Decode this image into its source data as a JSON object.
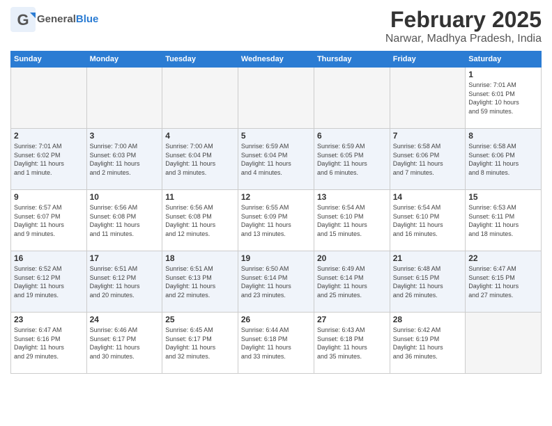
{
  "header": {
    "logo_general": "General",
    "logo_blue": "Blue",
    "main_title": "February 2025",
    "subtitle": "Narwar, Madhya Pradesh, India"
  },
  "columns": [
    "Sunday",
    "Monday",
    "Tuesday",
    "Wednesday",
    "Thursday",
    "Friday",
    "Saturday"
  ],
  "weeks": [
    {
      "shaded": false,
      "days": [
        {
          "num": "",
          "info": ""
        },
        {
          "num": "",
          "info": ""
        },
        {
          "num": "",
          "info": ""
        },
        {
          "num": "",
          "info": ""
        },
        {
          "num": "",
          "info": ""
        },
        {
          "num": "",
          "info": ""
        },
        {
          "num": "1",
          "info": "Sunrise: 7:01 AM\nSunset: 6:01 PM\nDaylight: 10 hours\nand 59 minutes."
        }
      ]
    },
    {
      "shaded": true,
      "days": [
        {
          "num": "2",
          "info": "Sunrise: 7:01 AM\nSunset: 6:02 PM\nDaylight: 11 hours\nand 1 minute."
        },
        {
          "num": "3",
          "info": "Sunrise: 7:00 AM\nSunset: 6:03 PM\nDaylight: 11 hours\nand 2 minutes."
        },
        {
          "num": "4",
          "info": "Sunrise: 7:00 AM\nSunset: 6:04 PM\nDaylight: 11 hours\nand 3 minutes."
        },
        {
          "num": "5",
          "info": "Sunrise: 6:59 AM\nSunset: 6:04 PM\nDaylight: 11 hours\nand 4 minutes."
        },
        {
          "num": "6",
          "info": "Sunrise: 6:59 AM\nSunset: 6:05 PM\nDaylight: 11 hours\nand 6 minutes."
        },
        {
          "num": "7",
          "info": "Sunrise: 6:58 AM\nSunset: 6:06 PM\nDaylight: 11 hours\nand 7 minutes."
        },
        {
          "num": "8",
          "info": "Sunrise: 6:58 AM\nSunset: 6:06 PM\nDaylight: 11 hours\nand 8 minutes."
        }
      ]
    },
    {
      "shaded": false,
      "days": [
        {
          "num": "9",
          "info": "Sunrise: 6:57 AM\nSunset: 6:07 PM\nDaylight: 11 hours\nand 9 minutes."
        },
        {
          "num": "10",
          "info": "Sunrise: 6:56 AM\nSunset: 6:08 PM\nDaylight: 11 hours\nand 11 minutes."
        },
        {
          "num": "11",
          "info": "Sunrise: 6:56 AM\nSunset: 6:08 PM\nDaylight: 11 hours\nand 12 minutes."
        },
        {
          "num": "12",
          "info": "Sunrise: 6:55 AM\nSunset: 6:09 PM\nDaylight: 11 hours\nand 13 minutes."
        },
        {
          "num": "13",
          "info": "Sunrise: 6:54 AM\nSunset: 6:10 PM\nDaylight: 11 hours\nand 15 minutes."
        },
        {
          "num": "14",
          "info": "Sunrise: 6:54 AM\nSunset: 6:10 PM\nDaylight: 11 hours\nand 16 minutes."
        },
        {
          "num": "15",
          "info": "Sunrise: 6:53 AM\nSunset: 6:11 PM\nDaylight: 11 hours\nand 18 minutes."
        }
      ]
    },
    {
      "shaded": true,
      "days": [
        {
          "num": "16",
          "info": "Sunrise: 6:52 AM\nSunset: 6:12 PM\nDaylight: 11 hours\nand 19 minutes."
        },
        {
          "num": "17",
          "info": "Sunrise: 6:51 AM\nSunset: 6:12 PM\nDaylight: 11 hours\nand 20 minutes."
        },
        {
          "num": "18",
          "info": "Sunrise: 6:51 AM\nSunset: 6:13 PM\nDaylight: 11 hours\nand 22 minutes."
        },
        {
          "num": "19",
          "info": "Sunrise: 6:50 AM\nSunset: 6:14 PM\nDaylight: 11 hours\nand 23 minutes."
        },
        {
          "num": "20",
          "info": "Sunrise: 6:49 AM\nSunset: 6:14 PM\nDaylight: 11 hours\nand 25 minutes."
        },
        {
          "num": "21",
          "info": "Sunrise: 6:48 AM\nSunset: 6:15 PM\nDaylight: 11 hours\nand 26 minutes."
        },
        {
          "num": "22",
          "info": "Sunrise: 6:47 AM\nSunset: 6:15 PM\nDaylight: 11 hours\nand 27 minutes."
        }
      ]
    },
    {
      "shaded": false,
      "days": [
        {
          "num": "23",
          "info": "Sunrise: 6:47 AM\nSunset: 6:16 PM\nDaylight: 11 hours\nand 29 minutes."
        },
        {
          "num": "24",
          "info": "Sunrise: 6:46 AM\nSunset: 6:17 PM\nDaylight: 11 hours\nand 30 minutes."
        },
        {
          "num": "25",
          "info": "Sunrise: 6:45 AM\nSunset: 6:17 PM\nDaylight: 11 hours\nand 32 minutes."
        },
        {
          "num": "26",
          "info": "Sunrise: 6:44 AM\nSunset: 6:18 PM\nDaylight: 11 hours\nand 33 minutes."
        },
        {
          "num": "27",
          "info": "Sunrise: 6:43 AM\nSunset: 6:18 PM\nDaylight: 11 hours\nand 35 minutes."
        },
        {
          "num": "28",
          "info": "Sunrise: 6:42 AM\nSunset: 6:19 PM\nDaylight: 11 hours\nand 36 minutes."
        },
        {
          "num": "",
          "info": ""
        }
      ]
    }
  ]
}
